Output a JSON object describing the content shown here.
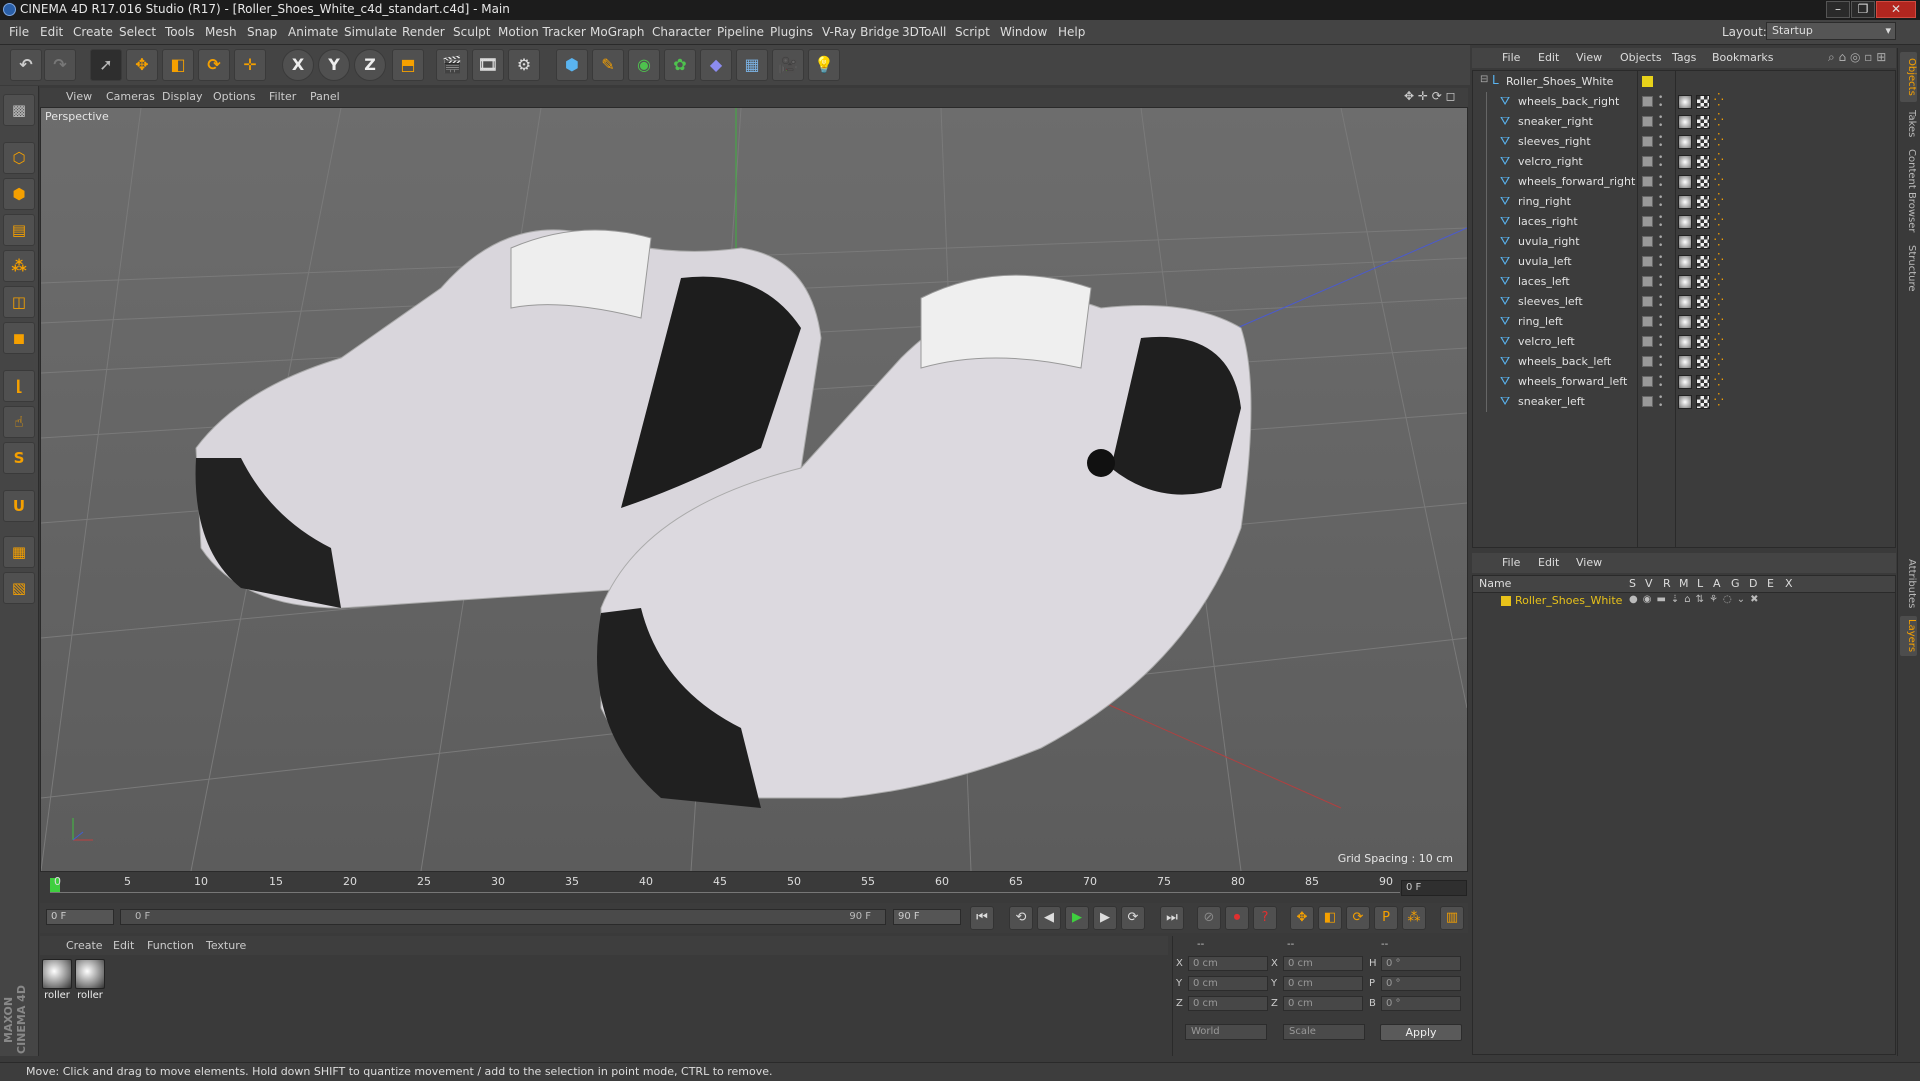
{
  "window": {
    "title": "CINEMA 4D R17.016 Studio (R17) - [Roller_Shoes_White_c4d_standart.c4d] - Main",
    "min": "–",
    "max": "❐",
    "close": "✕"
  },
  "menu": [
    "File",
    "Edit",
    "Create",
    "Select",
    "Tools",
    "Mesh",
    "Snap",
    "Animate",
    "Simulate",
    "Render",
    "Sculpt",
    "Motion Tracker",
    "MoGraph",
    "Character",
    "Pipeline",
    "Plugins",
    "V-Ray Bridge",
    "3DToAll",
    "Script",
    "Window",
    "Help"
  ],
  "layout": {
    "label": "Layout:",
    "value": "Startup"
  },
  "toolbar_axes": [
    "X",
    "Y",
    "Z"
  ],
  "viewport": {
    "menu": [
      "View",
      "Cameras",
      "Display",
      "Options",
      "Filter",
      "Panel"
    ],
    "label": "Perspective",
    "grid_spacing": "Grid Spacing : 10 cm"
  },
  "timeline": {
    "ticks": [
      "0",
      "5",
      "10",
      "15",
      "20",
      "25",
      "30",
      "35",
      "40",
      "45",
      "50",
      "55",
      "60",
      "65",
      "70",
      "75",
      "80",
      "85",
      "90"
    ],
    "current_frame": "0 F",
    "start_field": "0 F",
    "range_start": "0 F",
    "range_end": "90 F",
    "end_field": "90 F"
  },
  "materials": {
    "menu": [
      "Create",
      "Edit",
      "Function",
      "Texture"
    ],
    "items": [
      {
        "label": "roller"
      },
      {
        "label": "roller"
      }
    ]
  },
  "coords": {
    "headers": [
      "--",
      "--",
      "--"
    ],
    "rows": [
      {
        "a": "X",
        "av": "0 cm",
        "b": "X",
        "bv": "0 cm",
        "c": "H",
        "cv": "0 °"
      },
      {
        "a": "Y",
        "av": "0 cm",
        "b": "Y",
        "bv": "0 cm",
        "c": "P",
        "cv": "0 °"
      },
      {
        "a": "Z",
        "av": "0 cm",
        "b": "Z",
        "bv": "0 cm",
        "c": "B",
        "cv": "0 °"
      }
    ],
    "mode": "World",
    "size_mode": "Scale",
    "apply": "Apply"
  },
  "status": "Move: Click and drag to move elements. Hold down SHIFT to quantize movement / add to the selection in point mode, CTRL to remove.",
  "objects": {
    "menu": [
      "File",
      "Edit",
      "View",
      "Objects",
      "Tags",
      "Bookmarks"
    ],
    "root": "Roller_Shoes_White",
    "children": [
      "wheels_back_right",
      "sneaker_right",
      "sleeves_right",
      "velcro_right",
      "wheels_forward_right",
      "ring_right",
      "laces_right",
      "uvula_right",
      "uvula_left",
      "laces_left",
      "sleeves_left",
      "ring_left",
      "velcro_left",
      "wheels_back_left",
      "wheels_forward_left",
      "sneaker_left"
    ]
  },
  "layers": {
    "menu": [
      "File",
      "Edit",
      "View"
    ],
    "columns": [
      "Name",
      "S",
      "V",
      "R",
      "M",
      "L",
      "A",
      "G",
      "D",
      "E",
      "X"
    ],
    "items": [
      {
        "name": "Roller_Shoes_White",
        "color": "#e8c21a"
      }
    ]
  },
  "right_tabs": [
    "Objects",
    "Takes",
    "Content Browser",
    "Structure",
    "Attributes",
    "Layers"
  ],
  "colors": {
    "accent": "#f5a000",
    "layer": "#e8c21a",
    "root_tag": "#e8d21a"
  }
}
